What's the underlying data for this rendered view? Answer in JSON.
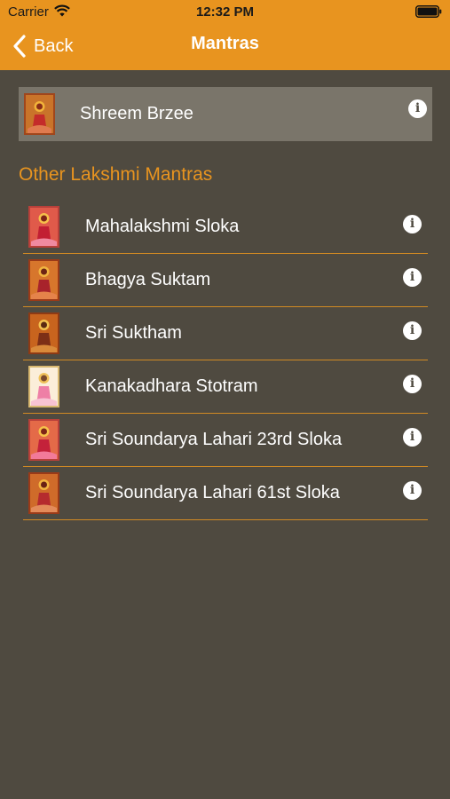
{
  "status_bar": {
    "carrier": "Carrier",
    "time": "12:32 PM"
  },
  "nav": {
    "back_label": "Back",
    "title": "Mantras"
  },
  "featured": {
    "label": "Shreem Brzee",
    "info_glyph": "i"
  },
  "section": {
    "title": "Other Lakshmi Mantras"
  },
  "items": [
    {
      "label": "Mahalakshmi Sloka",
      "info_glyph": "i"
    },
    {
      "label": "Bhagya Suktam",
      "info_glyph": "i"
    },
    {
      "label": "Sri Suktham",
      "info_glyph": "i"
    },
    {
      "label": "Kanakadhara Stotram",
      "info_glyph": "i"
    },
    {
      "label": "Sri Soundarya Lahari 23rd Sloka",
      "info_glyph": "i"
    },
    {
      "label": "Sri Soundarya Lahari 61st Sloka",
      "info_glyph": "i"
    }
  ],
  "colors": {
    "background": "#4f4a40",
    "accent": "#e8941f",
    "selected_row": "#7a756a",
    "divider": "#d28a23"
  }
}
